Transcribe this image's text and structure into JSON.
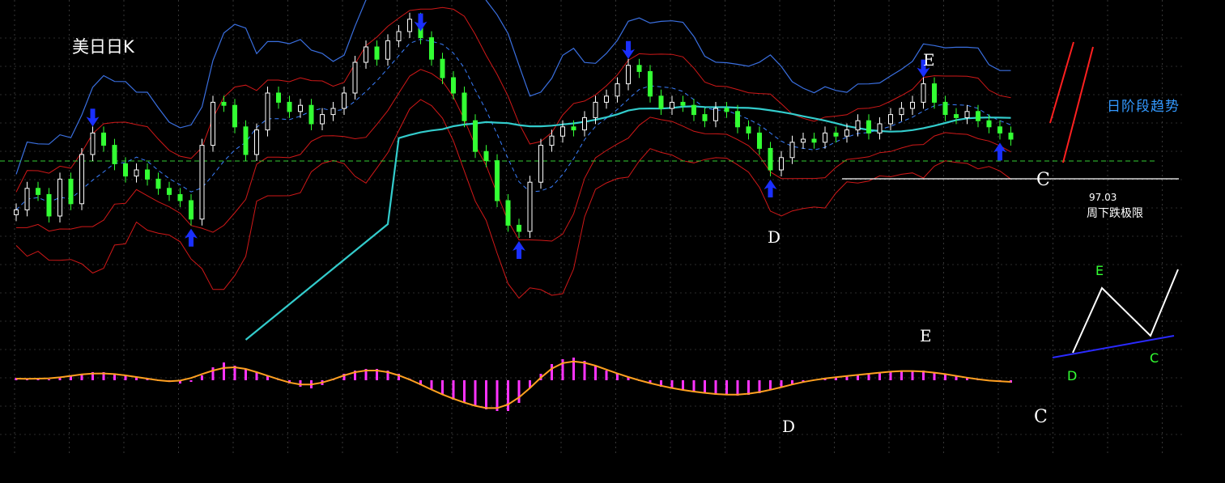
{
  "title": "美日日K",
  "trend_label": "日阶段趋势",
  "price_annotation": {
    "value": "97.03",
    "text": "周下跌极限"
  },
  "wave_labels": {
    "D": "D",
    "E": "E",
    "C": "C"
  },
  "inset_labels": {
    "D": "D",
    "E": "E",
    "C": "C"
  },
  "colors": {
    "background": "#000000",
    "bull_candle": "#ffffff",
    "bear_candle": "#33ff33",
    "bollinger_outer": "#3a6fe0",
    "bollinger_inner": "#d01818",
    "bollinger_mid": "#3a7fff",
    "long_ma": "#33cccc",
    "macd_hist": "#ff33ff",
    "macd_signal": "#ffa020",
    "arrow": "#1a2fff",
    "trend_lines": "#ff2020",
    "inset_base": "#2a2aff",
    "inset_label": "#33ff33"
  },
  "chart_data": [
    {
      "type": "candlestick",
      "panel": "price",
      "overlays": [
        "bollinger bands (outer)",
        "bollinger bands (inner)",
        "mid line",
        "long moving average"
      ],
      "markers": [
        {
          "index": 7,
          "direction": "down"
        },
        {
          "index": 16,
          "direction": "up"
        },
        {
          "index": 37,
          "direction": "down"
        },
        {
          "index": 46,
          "direction": "up"
        },
        {
          "index": 56,
          "direction": "down"
        },
        {
          "index": 69,
          "direction": "up"
        },
        {
          "index": 83,
          "direction": "down"
        },
        {
          "index": 90,
          "direction": "up"
        }
      ],
      "wave_points": [
        {
          "label": "D",
          "index": 69
        },
        {
          "label": "E",
          "index": 83
        },
        {
          "label": "C",
          "index": 91
        }
      ],
      "support_value": 97.03,
      "y_relative": [
        0.37,
        0.44,
        0.42,
        0.35,
        0.47,
        0.39,
        0.55,
        0.62,
        0.58,
        0.52,
        0.48,
        0.5,
        0.47,
        0.44,
        0.42,
        0.4,
        0.34,
        0.58,
        0.72,
        0.71,
        0.64,
        0.55,
        0.63,
        0.75,
        0.72,
        0.69,
        0.71,
        0.65,
        0.68,
        0.7,
        0.75,
        0.85,
        0.9,
        0.86,
        0.92,
        0.95,
        0.99,
        0.93,
        0.86,
        0.8,
        0.75,
        0.66,
        0.56,
        0.53,
        0.4,
        0.32,
        0.3,
        0.46,
        0.58,
        0.61,
        0.64,
        0.63,
        0.67,
        0.72,
        0.74,
        0.78,
        0.84,
        0.82,
        0.74,
        0.7,
        0.72,
        0.71,
        0.68,
        0.66,
        0.7,
        0.69,
        0.64,
        0.62,
        0.57,
        0.5,
        0.54,
        0.59,
        0.6,
        0.59,
        0.62,
        0.61,
        0.63,
        0.66,
        0.62,
        0.65,
        0.68,
        0.7,
        0.72,
        0.78,
        0.72,
        0.68,
        0.67,
        0.69,
        0.66,
        0.64,
        0.62,
        0.6
      ]
    },
    {
      "type": "histogram+line",
      "panel": "oscillator",
      "series": [
        {
          "values": [
            0.3,
            0.2,
            0.1,
            0.1,
            0.3,
            0.5,
            0.8,
            1.0,
            1.0,
            0.8,
            0.6,
            0.4,
            0.2,
            0.0,
            -0.2,
            -0.4,
            -0.2,
            0.6,
            1.6,
            2.2,
            1.8,
            1.4,
            1.0,
            0.6,
            0.2,
            -0.4,
            -0.8,
            -1.0,
            -0.6,
            0.2,
            0.8,
            1.2,
            1.4,
            1.4,
            1.2,
            0.8,
            0.2,
            -0.6,
            -1.2,
            -1.8,
            -2.4,
            -2.8,
            -3.2,
            -3.6,
            -3.8,
            -3.8,
            -2.8,
            -1.0,
            0.8,
            2.0,
            2.6,
            2.8,
            2.4,
            1.8,
            1.2,
            0.8,
            0.4,
            0.0,
            -0.4,
            -0.8,
            -1.0,
            -1.2,
            -1.4,
            -1.6,
            -1.8,
            -1.8,
            -1.9,
            -1.8,
            -1.6,
            -1.2,
            -0.8,
            -0.5,
            -0.2,
            0.1,
            0.3,
            0.4,
            0.5,
            0.6,
            0.8,
            1.0,
            1.1,
            1.2,
            1.2,
            1.2,
            1.0,
            0.8,
            0.5,
            0.3,
            0.1,
            -0.1,
            -0.2,
            -0.3
          ]
        }
      ]
    }
  ]
}
